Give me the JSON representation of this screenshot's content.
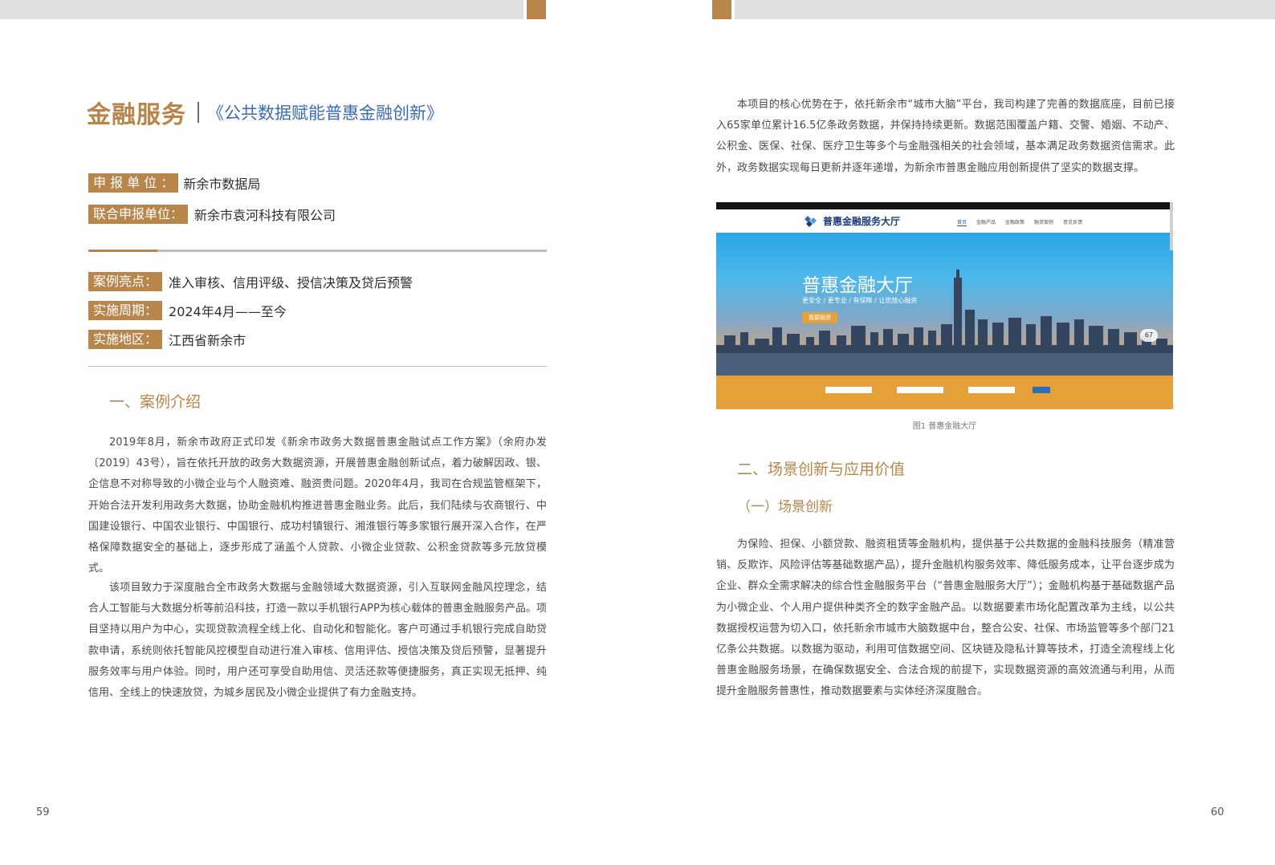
{
  "header": {
    "title": "金融服务",
    "subtitle": "《公共数据赋能普惠金融创新》"
  },
  "info": {
    "applicant": {
      "label": "申 报 单 位 ：",
      "value": "新余市数据局"
    },
    "co_applicant": {
      "label": "联合申报单位：",
      "value": "新余市袁河科技有限公司"
    },
    "highlights": {
      "label": "案例亮点：",
      "value": "准入审核、信用评级、授信决策及贷后预警"
    },
    "period": {
      "label": "实施周期：",
      "value": "2024年4月——至今"
    },
    "region": {
      "label": "实施地区：",
      "value": "江西省新余市"
    }
  },
  "section1": {
    "heading": "一、案例介绍",
    "para1": "2019年8月，新余市政府正式印发《新余市政务大数据普惠金融试点工作方案》（余府办发〔2019〕43号），旨在依托开放的政务大数据资源，开展普惠金融创新试点，着力破解因政、银、企信息不对称导致的小微企业与个人融资难、融资贵问题。2020年4月，我司在合规监管框架下，开始合法开发利用政务大数据，协助金融机构推进普惠金融业务。此后，我们陆续与农商银行、中国建设银行、中国农业银行、中国银行、成功村镇银行、湘淮银行等多家银行展开深入合作，在严格保障数据安全的基础上，逐步形成了涵盖个人贷款、小微企业贷款、公积金贷款等多元放贷模式。",
    "para2": "该项目致力于深度融合全市政务大数据与金融领域大数据资源，引入互联网金融风控理念，结合人工智能与大数据分析等前沿科技，打造一款以手机银行APP为核心载体的普惠金融服务产品。项目坚持以用户为中心，实现贷款流程全线上化、自动化和智能化。客户可通过手机银行完成自助贷款申请，系统则依托智能风控模型自动进行准入审核、信用评估、授信决策及贷后预警，显著提升服务效率与用户体验。同时，用户还可享受自助用信、灵活还款等便捷服务，真正实现无抵押、纯信用、全线上的快速放贷，为城乡居民及小微企业提供了有力金融支持。"
  },
  "right": {
    "intro": "本项目的核心优势在于，依托新余市“城市大脑”平台，我司构建了完善的数据底座，目前已接入65家单位累计16.5亿条政务数据，并保持持续更新。数据范围覆盖户籍、交警、婚姻、不动产、公积金、医保、社保、医疗卫生等多个与金融强相关的社会领域，基本满足政务数据资信需求。此外，政务数据实现每日更新并逐年递增，为新余市普惠金融应用创新提供了坚实的数据支撑。",
    "screenshot": {
      "brand": "普惠金融服务大厅",
      "menu": [
        "首页",
        "金融产品",
        "金融政策",
        "融资案例",
        "意见反馈"
      ],
      "hero_title": "普惠金融大厅",
      "hero_tagline": "更安全 / 更专业 / 有保障 / 让您放心融资",
      "hero_button": "我要融资",
      "badge": "67",
      "brand_color": "#1f3d7a",
      "accent_color": "#e6a03a"
    },
    "caption": "图1 普惠金融大厅",
    "section2_heading": "二、场景创新与应用价值",
    "sub1_heading": "（一）场景创新",
    "para3": "为保险、担保、小额贷款、融资租赁等金融机构，提供基于公共数据的金融科技服务（精准营销、反欺诈、风险评估等基础数据产品），提升金融机构服务效率、降低服务成本，让平台逐步成为企业、群众全需求解决的综合性金融服务平台（“普惠金融服务大厅”）；金融机构基于基础数据产品为小微企业、个人用户提供种类齐全的数字金融产品。以数据要素市场化配置改革为主线，以公共数据授权运营为切入口，依托新余市城市大脑数据中台，整合公安、社保、市场监管等多个部门21亿条公共数据。以数据为驱动，利用可信数据空间、区块链及隐私计算等技术，打造全流程线上化普惠金融服务场景，在确保数据安全、合法合规的前提下，实现数据资源的高效流通与利用，从而提升金融服务普惠性，推动数据要素与实体经济深度融合。"
  },
  "page_numbers": {
    "left": "59",
    "right": "60"
  },
  "theme": {
    "accent": "#b8854a",
    "subtitle_color": "#3b6bb5"
  }
}
